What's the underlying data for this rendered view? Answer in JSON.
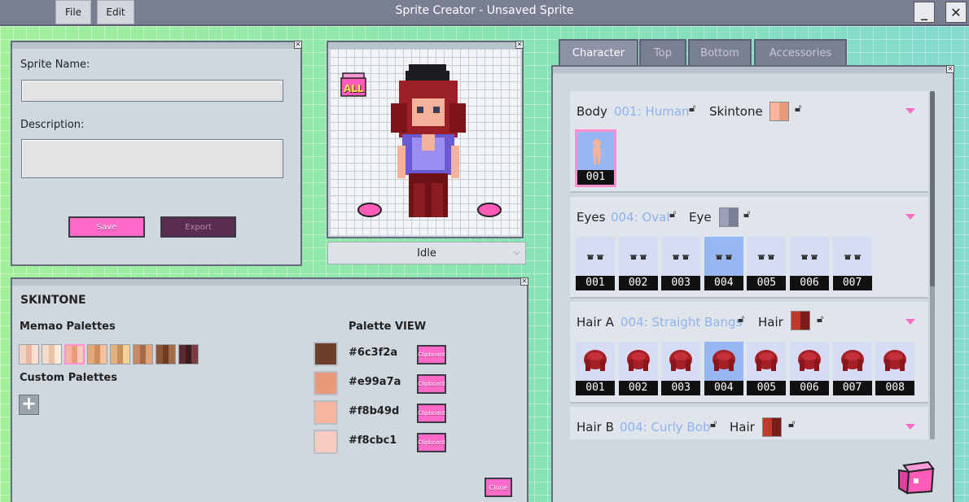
{
  "window": {
    "title": "Sprite Creator - Unsaved Sprite",
    "menu": [
      "File",
      "Edit"
    ],
    "minimize": "_",
    "close": "✕"
  },
  "sprite_info": {
    "name_label": "Sprite Name:",
    "name_value": "",
    "description_label": "Description:",
    "description_value": "",
    "save_label": "Save",
    "export_label": "Export"
  },
  "preview": {
    "all_badge": "ALL",
    "animation": "Idle"
  },
  "skintone": {
    "heading": "SKINTONE",
    "memao_label": "Memao Palettes",
    "custom_label": "Custom Palettes",
    "add_label": "+",
    "palette_view_label": "Palette VIEW",
    "memao_palettes": [
      [
        "#f2d4c7",
        "#e9b8a5",
        "#f7e0d3"
      ],
      [
        "#f4dccb",
        "#e7c2a6",
        "#fcebdc"
      ],
      [
        "#f8b49d",
        "#e99a7a",
        "#f8cbc1"
      ],
      [
        "#e2a878",
        "#cf8d5e",
        "#f0c39a"
      ],
      [
        "#e3b07a",
        "#c8915b",
        "#f2cf9b"
      ],
      [
        "#c58a5e",
        "#a66a45",
        "#dba47a"
      ],
      [
        "#8a5534",
        "#6b3c22",
        "#a56b46"
      ],
      [
        "#5a2a2e",
        "#3b1a1e",
        "#7a3d44"
      ]
    ],
    "selected_palette": 2,
    "palette_view": [
      {
        "hex": "#6c3f2a",
        "clip": "Clipboard"
      },
      {
        "hex": "#e99a7a",
        "clip": "Clipboard"
      },
      {
        "hex": "#f8b49d",
        "clip": "Clipboard"
      },
      {
        "hex": "#f8cbc1",
        "clip": "Clipboard"
      }
    ],
    "clone_label": "Clone"
  },
  "tabs": [
    "Character",
    "Top",
    "Bottom",
    "Accessories"
  ],
  "active_tab": 0,
  "sections": {
    "body": {
      "title": "Body",
      "value": "001: Human",
      "sub_label": "Skintone",
      "chip": [
        "#f8b49d",
        "#e99a7a"
      ],
      "tiles": [
        "001"
      ],
      "selected": 0
    },
    "eyes": {
      "title": "Eyes",
      "value": "004: Oval",
      "sub_label": "Eye",
      "chip": [
        "#9aa0b8",
        "#7a7f98"
      ],
      "tiles": [
        "001",
        "002",
        "003",
        "004",
        "005",
        "006",
        "007"
      ],
      "selected": 3
    },
    "hair_a": {
      "title": "Hair A",
      "value": "004: Straight Bangs",
      "sub_label": "Hair",
      "chip": [
        "#c0392b",
        "#7a1c1c"
      ],
      "tiles": [
        "001",
        "002",
        "003",
        "004",
        "005",
        "006",
        "007",
        "008"
      ],
      "selected": 3
    },
    "hair_b": {
      "title": "Hair B",
      "value": "004: Curly Bob",
      "sub_label": "Hair",
      "chip": [
        "#c0392b",
        "#7a1c1c"
      ]
    }
  }
}
